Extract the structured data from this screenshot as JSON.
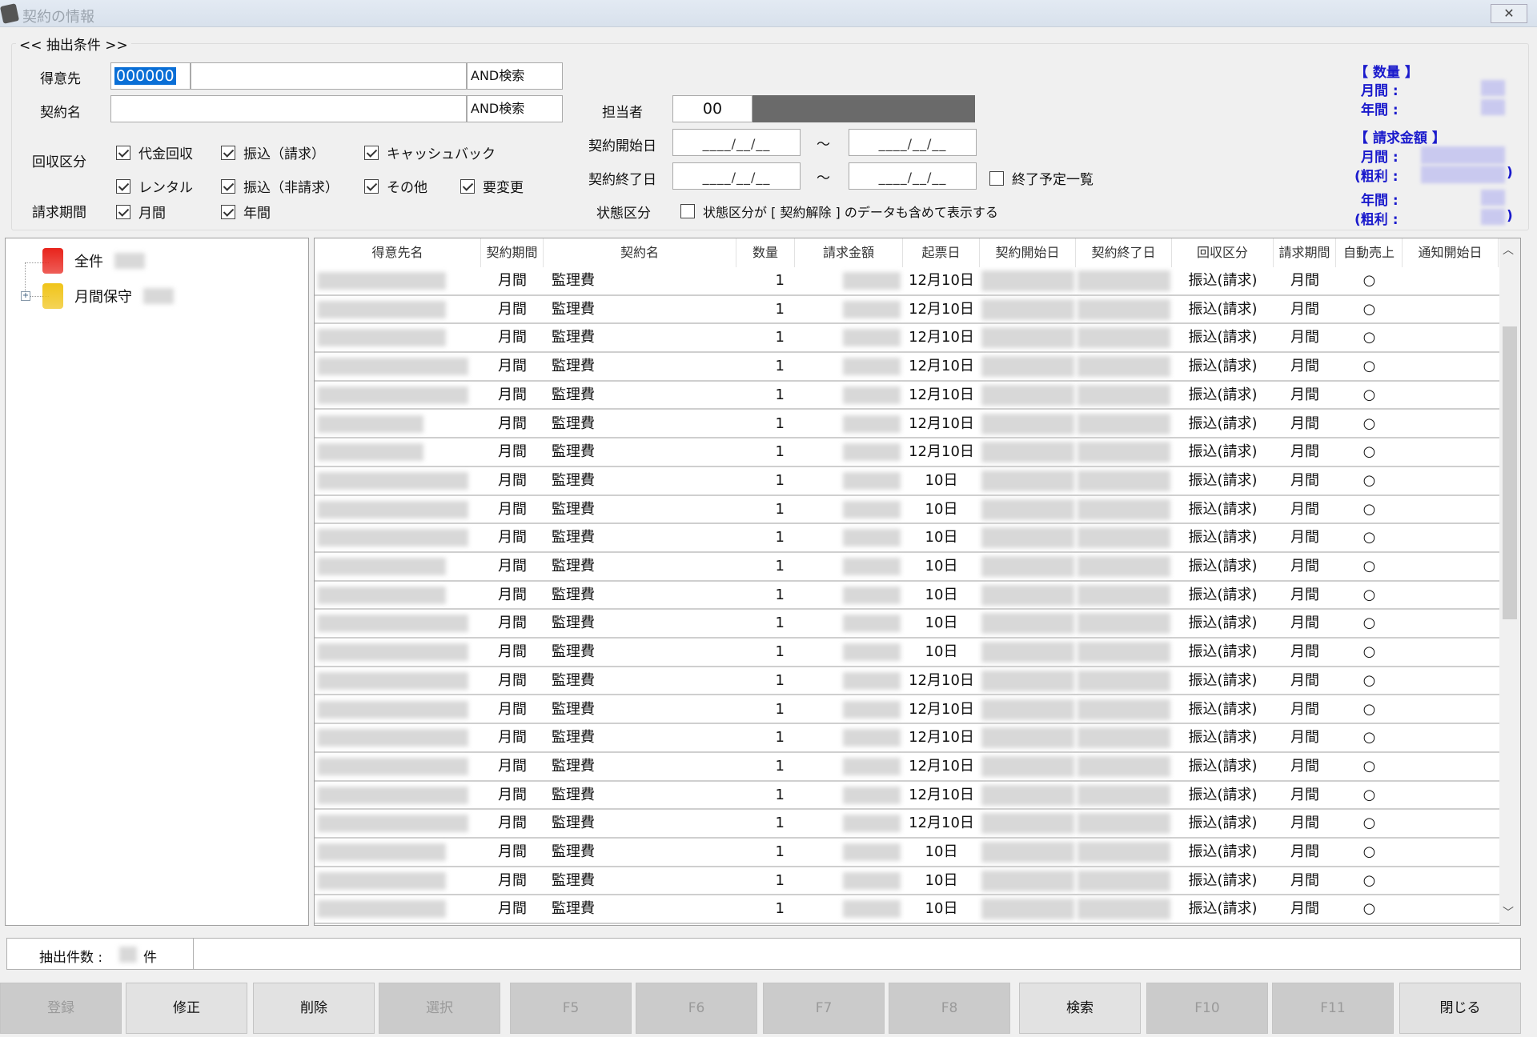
{
  "window": {
    "title": "契約の情報",
    "close_label": "✕"
  },
  "filter": {
    "group_label": "<< 抽出条件 >>",
    "customer_label": "得意先",
    "customer_code": "000000",
    "customer_name": "",
    "and_search_1": "AND検索",
    "contract_name_label": "契約名",
    "contract_name": "",
    "and_search_2": "AND検索",
    "collection_label": "回収区分",
    "collection_options": [
      {
        "label": "代金回収",
        "checked": true
      },
      {
        "label": "振込（請求）",
        "checked": true
      },
      {
        "label": "キャッシュバック",
        "checked": true
      },
      {
        "label": "レンタル",
        "checked": true
      },
      {
        "label": "振込（非請求）",
        "checked": true
      },
      {
        "label": "その他",
        "checked": true
      },
      {
        "label": "要変更",
        "checked": true
      }
    ],
    "billing_period_label": "請求期間",
    "billing_options": [
      {
        "label": "月間",
        "checked": true
      },
      {
        "label": "年間",
        "checked": true
      }
    ],
    "staff_label": "担当者",
    "staff_code": "00",
    "start_date_label": "契約開始日",
    "end_date_label": "契約終了日",
    "date_placeholder": "____/__/__",
    "tilde": "～",
    "end_schedule": {
      "label": "終了予定一覧",
      "checked": false
    },
    "status_label": "状態区分",
    "status_option": {
      "label": "状態区分が [ 契約解除 ] のデータも含めて表示する",
      "checked": false
    }
  },
  "summary": {
    "qty_title": "【 数量 】",
    "monthly": "月間 :",
    "yearly": "年間 :",
    "amount_title": "【 請求金額 】",
    "profit": "(粗利 :",
    "paren": ")"
  },
  "tree": {
    "items": [
      {
        "label": "全件",
        "color": "#e8231b"
      },
      {
        "label": "月間保守",
        "color": "#f0c419"
      }
    ]
  },
  "grid": {
    "columns": [
      "得意先名",
      "契約期間",
      "契約名",
      "数量",
      "請求金額",
      "起票日",
      "契約開始日",
      "契約終了日",
      "回収区分",
      "請求期間",
      "自動売上",
      "通知開始日"
    ],
    "rows": [
      {
        "period": "月間",
        "name": "監理費",
        "qty": "1",
        "issue": "12月10日",
        "collect": "振込(請求)",
        "billing": "月間",
        "auto": "○"
      },
      {
        "period": "月間",
        "name": "監理費",
        "qty": "1",
        "issue": "12月10日",
        "collect": "振込(請求)",
        "billing": "月間",
        "auto": "○"
      },
      {
        "period": "月間",
        "name": "監理費",
        "qty": "1",
        "issue": "12月10日",
        "collect": "振込(請求)",
        "billing": "月間",
        "auto": "○"
      },
      {
        "period": "月間",
        "name": "監理費",
        "qty": "1",
        "issue": "12月10日",
        "collect": "振込(請求)",
        "billing": "月間",
        "auto": "○"
      },
      {
        "period": "月間",
        "name": "監理費",
        "qty": "1",
        "issue": "12月10日",
        "collect": "振込(請求)",
        "billing": "月間",
        "auto": "○"
      },
      {
        "period": "月間",
        "name": "監理費",
        "qty": "1",
        "issue": "12月10日",
        "collect": "振込(請求)",
        "billing": "月間",
        "auto": "○"
      },
      {
        "period": "月間",
        "name": "監理費",
        "qty": "1",
        "issue": "12月10日",
        "collect": "振込(請求)",
        "billing": "月間",
        "auto": "○"
      },
      {
        "period": "月間",
        "name": "監理費",
        "qty": "1",
        "issue": "10日",
        "collect": "振込(請求)",
        "billing": "月間",
        "auto": "○"
      },
      {
        "period": "月間",
        "name": "監理費",
        "qty": "1",
        "issue": "10日",
        "collect": "振込(請求)",
        "billing": "月間",
        "auto": "○"
      },
      {
        "period": "月間",
        "name": "監理費",
        "qty": "1",
        "issue": "10日",
        "collect": "振込(請求)",
        "billing": "月間",
        "auto": "○"
      },
      {
        "period": "月間",
        "name": "監理費",
        "qty": "1",
        "issue": "10日",
        "collect": "振込(請求)",
        "billing": "月間",
        "auto": "○"
      },
      {
        "period": "月間",
        "name": "監理費",
        "qty": "1",
        "issue": "10日",
        "collect": "振込(請求)",
        "billing": "月間",
        "auto": "○"
      },
      {
        "period": "月間",
        "name": "監理費",
        "qty": "1",
        "issue": "10日",
        "collect": "振込(請求)",
        "billing": "月間",
        "auto": "○"
      },
      {
        "period": "月間",
        "name": "監理費",
        "qty": "1",
        "issue": "10日",
        "collect": "振込(請求)",
        "billing": "月間",
        "auto": "○"
      },
      {
        "period": "月間",
        "name": "監理費",
        "qty": "1",
        "issue": "12月10日",
        "collect": "振込(請求)",
        "billing": "月間",
        "auto": "○"
      },
      {
        "period": "月間",
        "name": "監理費",
        "qty": "1",
        "issue": "12月10日",
        "collect": "振込(請求)",
        "billing": "月間",
        "auto": "○"
      },
      {
        "period": "月間",
        "name": "監理費",
        "qty": "1",
        "issue": "12月10日",
        "collect": "振込(請求)",
        "billing": "月間",
        "auto": "○"
      },
      {
        "period": "月間",
        "name": "監理費",
        "qty": "1",
        "issue": "12月10日",
        "collect": "振込(請求)",
        "billing": "月間",
        "auto": "○"
      },
      {
        "period": "月間",
        "name": "監理費",
        "qty": "1",
        "issue": "12月10日",
        "collect": "振込(請求)",
        "billing": "月間",
        "auto": "○"
      },
      {
        "period": "月間",
        "name": "監理費",
        "qty": "1",
        "issue": "12月10日",
        "collect": "振込(請求)",
        "billing": "月間",
        "auto": "○"
      },
      {
        "period": "月間",
        "name": "監理費",
        "qty": "1",
        "issue": "10日",
        "collect": "振込(請求)",
        "billing": "月間",
        "auto": "○"
      },
      {
        "period": "月間",
        "name": "監理費",
        "qty": "1",
        "issue": "10日",
        "collect": "振込(請求)",
        "billing": "月間",
        "auto": "○"
      },
      {
        "period": "月間",
        "name": "監理費",
        "qty": "1",
        "issue": "10日",
        "collect": "振込(請求)",
        "billing": "月間",
        "auto": "○"
      }
    ]
  },
  "status": {
    "count_label": "抽出件数 :",
    "count_unit": "件"
  },
  "buttons": [
    {
      "label": "登録",
      "enabled": false
    },
    {
      "label": "修正",
      "enabled": true
    },
    {
      "label": "削除",
      "enabled": true
    },
    {
      "label": "選択",
      "enabled": false
    },
    {
      "label": "F5",
      "enabled": false
    },
    {
      "label": "F6",
      "enabled": false
    },
    {
      "label": "F7",
      "enabled": false
    },
    {
      "label": "F8",
      "enabled": false
    },
    {
      "label": "検索",
      "enabled": true
    },
    {
      "label": "F10",
      "enabled": false
    },
    {
      "label": "F11",
      "enabled": false
    },
    {
      "label": "閉じる",
      "enabled": true
    }
  ]
}
